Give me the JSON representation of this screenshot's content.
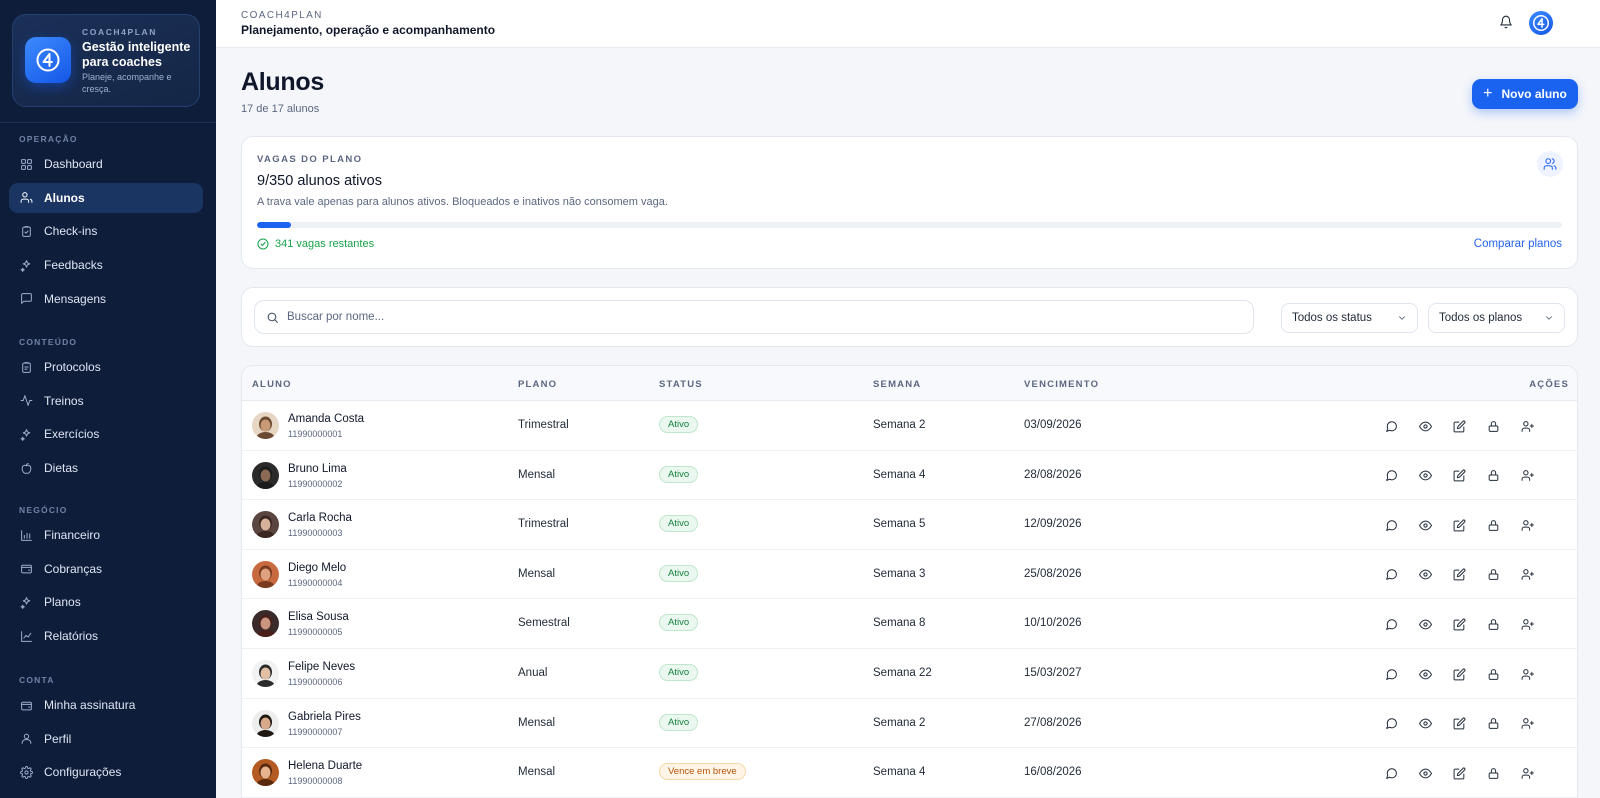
{
  "brand": {
    "kicker": "COACH4PLAN",
    "title": "Gestão inteligente para coaches",
    "subtitle": "Planeje, acompanhe e cresça."
  },
  "sidebar": {
    "sections": [
      {
        "label": "OPERAÇÃO",
        "items": [
          {
            "label": "Dashboard",
            "icon": "dashboard-icon",
            "active": false
          },
          {
            "label": "Alunos",
            "icon": "users-icon",
            "active": true
          },
          {
            "label": "Check-ins",
            "icon": "clipboard-check-icon",
            "active": false
          },
          {
            "label": "Feedbacks",
            "icon": "sparkles-icon",
            "active": false
          },
          {
            "label": "Mensagens",
            "icon": "message-icon",
            "active": false
          }
        ]
      },
      {
        "label": "CONTEÚDO",
        "items": [
          {
            "label": "Protocolos",
            "icon": "clipboard-icon",
            "active": false
          },
          {
            "label": "Treinos",
            "icon": "activity-icon",
            "active": false
          },
          {
            "label": "Exercícios",
            "icon": "sparkles-icon",
            "active": false
          },
          {
            "label": "Dietas",
            "icon": "apple-icon",
            "active": false
          }
        ]
      },
      {
        "label": "NEGÓCIO",
        "items": [
          {
            "label": "Financeiro",
            "icon": "bar-chart-icon",
            "active": false
          },
          {
            "label": "Cobranças",
            "icon": "wallet-icon",
            "active": false
          },
          {
            "label": "Planos",
            "icon": "sparkles-icon",
            "active": false
          },
          {
            "label": "Relatórios",
            "icon": "line-chart-icon",
            "active": false
          }
        ]
      },
      {
        "label": "CONTA",
        "items": [
          {
            "label": "Minha assinatura",
            "icon": "wallet-icon",
            "active": false
          },
          {
            "label": "Perfil",
            "icon": "user-icon",
            "active": false
          },
          {
            "label": "Configurações",
            "icon": "gear-icon",
            "active": false
          }
        ]
      }
    ]
  },
  "topbar": {
    "kicker": "COACH4PLAN",
    "title": "Planejamento, operação e acompanhamento"
  },
  "page": {
    "title": "Alunos",
    "count": "17 de 17 alunos",
    "new_button": "Novo aluno"
  },
  "plan": {
    "kicker": "VAGAS DO PLANO",
    "active": "9/350 alunos ativos",
    "note": "A trava vale apenas para alunos ativos. Bloqueados e inativos não consomem vaga.",
    "used_fraction": 0.0257,
    "remaining": "341 vagas restantes",
    "compare": "Comparar planos"
  },
  "filters": {
    "search_placeholder": "Buscar por nome...",
    "status": "Todos os status",
    "plan": "Todos os planos"
  },
  "table": {
    "headers": {
      "student": "ALUNO",
      "plan": "PLANO",
      "status": "STATUS",
      "week": "SEMANA",
      "due": "VENCIMENTO",
      "actions": "AÇÕES"
    },
    "rows": [
      {
        "name": "Amanda Costa",
        "phone": "11990000001",
        "plan": "Trimestral",
        "status": "Ativo",
        "status_kind": "ativo",
        "week": "Semana 2",
        "due": "03/09/2026"
      },
      {
        "name": "Bruno Lima",
        "phone": "11990000002",
        "plan": "Mensal",
        "status": "Ativo",
        "status_kind": "ativo",
        "week": "Semana 4",
        "due": "28/08/2026"
      },
      {
        "name": "Carla Rocha",
        "phone": "11990000003",
        "plan": "Trimestral",
        "status": "Ativo",
        "status_kind": "ativo",
        "week": "Semana 5",
        "due": "12/09/2026"
      },
      {
        "name": "Diego Melo",
        "phone": "11990000004",
        "plan": "Mensal",
        "status": "Ativo",
        "status_kind": "ativo",
        "week": "Semana 3",
        "due": "25/08/2026"
      },
      {
        "name": "Elisa Sousa",
        "phone": "11990000005",
        "plan": "Semestral",
        "status": "Ativo",
        "status_kind": "ativo",
        "week": "Semana 8",
        "due": "10/10/2026"
      },
      {
        "name": "Felipe Neves",
        "phone": "11990000006",
        "plan": "Anual",
        "status": "Ativo",
        "status_kind": "ativo",
        "week": "Semana 22",
        "due": "15/03/2027"
      },
      {
        "name": "Gabriela Pires",
        "phone": "11990000007",
        "plan": "Mensal",
        "status": "Ativo",
        "status_kind": "ativo",
        "week": "Semana 2",
        "due": "27/08/2026"
      },
      {
        "name": "Helena Duarte",
        "phone": "11990000008",
        "plan": "Mensal",
        "status": "Vence em breve",
        "status_kind": "vence",
        "week": "Semana 4",
        "due": "16/08/2026"
      }
    ]
  },
  "colors": {
    "sidebar_bg": "#0e1d3a",
    "accent": "#1a63f0",
    "success": "#16a34a",
    "warning": "#b45309"
  }
}
